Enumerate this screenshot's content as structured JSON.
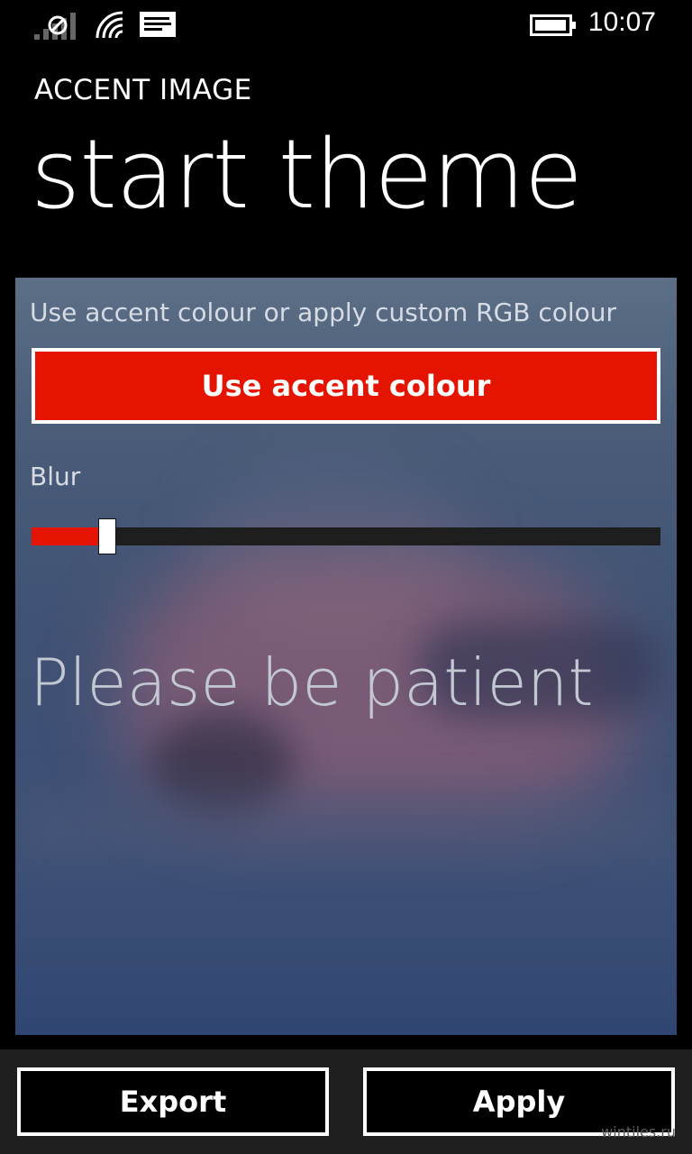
{
  "status_bar": {
    "time": "10:07",
    "icons": [
      "signal-icon",
      "wifi-icon",
      "message-icon",
      "battery-icon"
    ]
  },
  "header": {
    "app_title": "ACCENT IMAGE",
    "page_title": "start theme"
  },
  "settings": {
    "accent_caption": "Use accent colour or apply custom RGB colour",
    "accent_button_label": "Use accent colour",
    "blur_label": "Blur",
    "blur_value": 0.12
  },
  "preview": {
    "message": "Please be patient"
  },
  "app_bar": {
    "export_label": "Export",
    "apply_label": "Apply"
  },
  "watermark": "wintiles.ru",
  "colors": {
    "accent": "#e51400",
    "background": "#000000",
    "text": "#ffffff"
  }
}
